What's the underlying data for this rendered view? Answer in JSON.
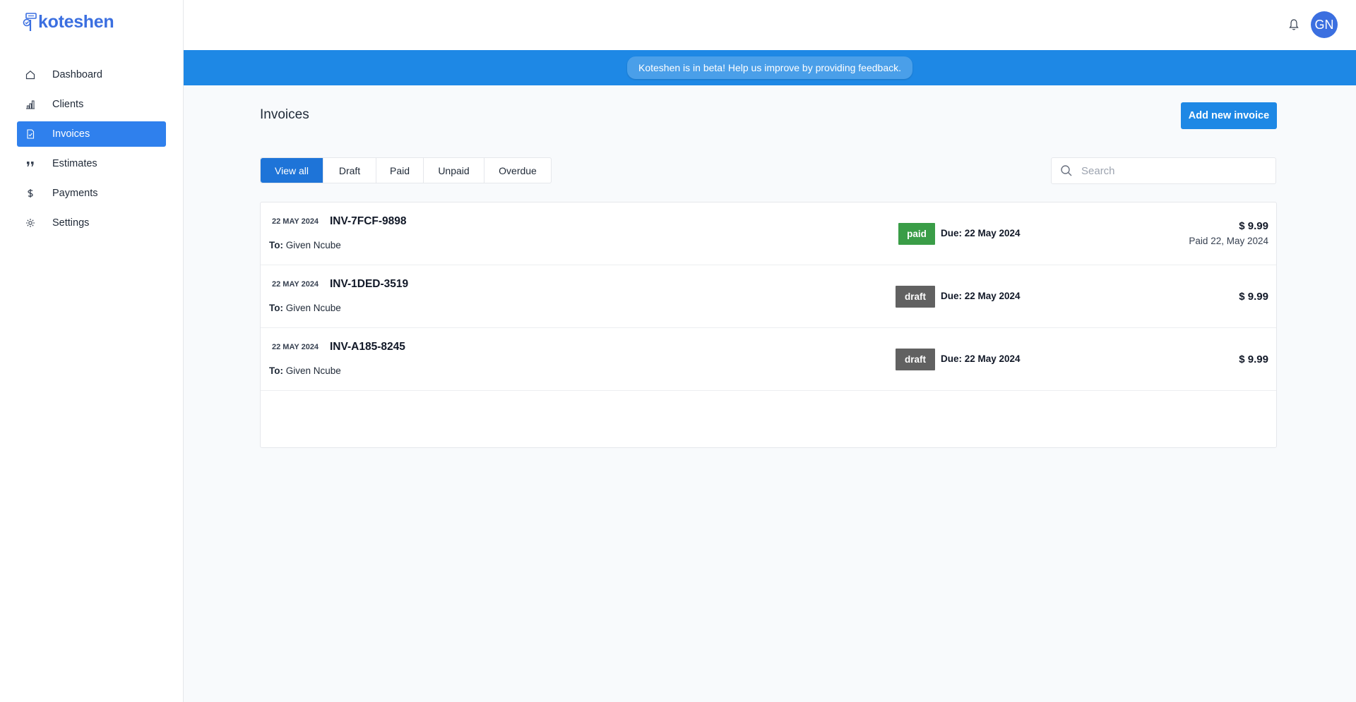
{
  "app": {
    "name": "koteshen"
  },
  "sidebar": {
    "items": [
      {
        "label": "Dashboard",
        "icon": "home-icon",
        "active": false
      },
      {
        "label": "Clients",
        "icon": "bar-chart-icon",
        "active": false
      },
      {
        "label": "Invoices",
        "icon": "document-check-icon",
        "active": true
      },
      {
        "label": "Estimates",
        "icon": "quote-icon",
        "active": false
      },
      {
        "label": "Payments",
        "icon": "dollar-icon",
        "active": false
      },
      {
        "label": "Settings",
        "icon": "gear-icon",
        "active": false
      }
    ]
  },
  "header": {
    "avatar_initials": "GN"
  },
  "banner": {
    "text": "Koteshen is in beta! Help us improve by providing feedback."
  },
  "main": {
    "title": "Invoices",
    "add_button": "Add new invoice",
    "filters": [
      "View all",
      "Draft",
      "Paid",
      "Unpaid",
      "Overdue"
    ],
    "active_filter": "View all",
    "search": {
      "placeholder": "Search",
      "value": ""
    },
    "invoices": [
      {
        "date": "22 MAY 2024",
        "number": "INV-7FCF-9898",
        "to_label": "To:",
        "to": "Given Ncube",
        "status": "paid",
        "due": "Due: 22 May 2024",
        "amount": "$ 9.99",
        "paid_note": "Paid 22, May 2024"
      },
      {
        "date": "22 MAY 2024",
        "number": "INV-1DED-3519",
        "to_label": "To:",
        "to": "Given Ncube",
        "status": "draft",
        "due": "Due: 22 May 2024",
        "amount": "$ 9.99",
        "paid_note": ""
      },
      {
        "date": "22 MAY 2024",
        "number": "INV-A185-8245",
        "to_label": "To:",
        "to": "Given Ncube",
        "status": "draft",
        "due": "Due: 22 May 2024",
        "amount": "$ 9.99",
        "paid_note": ""
      }
    ]
  },
  "colors": {
    "primary": "#1e88e5",
    "active_nav": "#2f80ed",
    "paid": "#3a9d47",
    "draft": "#616161",
    "logo": "#3b6fe0"
  }
}
